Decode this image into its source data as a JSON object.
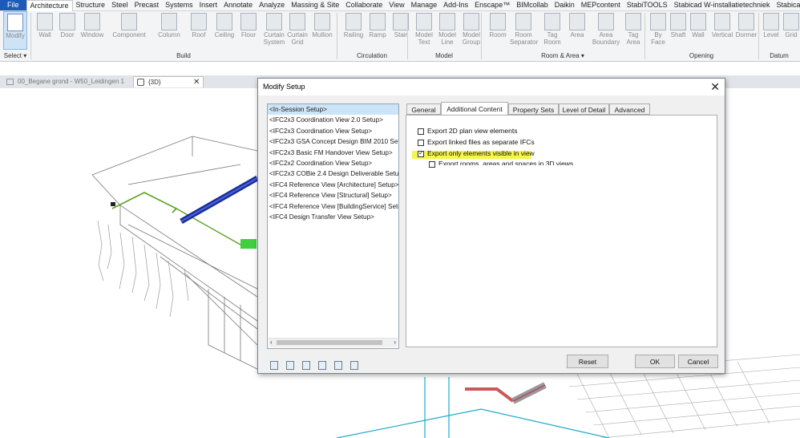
{
  "menu": {
    "tabs": [
      "File",
      "Architecture",
      "Structure",
      "Steel",
      "Precast",
      "Systems",
      "Insert",
      "Annotate",
      "Analyze",
      "Massing & Site",
      "Collaborate",
      "View",
      "Manage",
      "Add-Ins",
      "Enscape™",
      "BIMcollab",
      "Daikin",
      "MEPcontent",
      "StabiTOOLS",
      "Stabicad W-installatietechniek",
      "Stabica"
    ],
    "active_tab": "Architecture"
  },
  "ribbon": {
    "tools": [
      {
        "label": "Modify",
        "icon": "cursor-icon"
      },
      {
        "label": "Wall",
        "icon": "wall-icon"
      },
      {
        "label": "Door",
        "icon": "door-icon"
      },
      {
        "label": "Window",
        "icon": "window-icon"
      },
      {
        "label": "Component",
        "icon": "component-icon"
      },
      {
        "label": "Column",
        "icon": "column-icon"
      },
      {
        "label": "Roof",
        "icon": "roof-icon"
      },
      {
        "label": "Ceiling",
        "icon": "ceiling-icon"
      },
      {
        "label": "Floor",
        "icon": "floor-icon"
      },
      {
        "label": "Curtain System",
        "icon": "curtain-system-icon"
      },
      {
        "label": "Curtain Grid",
        "icon": "curtain-grid-icon"
      },
      {
        "label": "Mullion",
        "icon": "mullion-icon"
      },
      {
        "label": "Railing",
        "icon": "railing-icon"
      },
      {
        "label": "Ramp",
        "icon": "ramp-icon"
      },
      {
        "label": "Stair",
        "icon": "stair-icon"
      },
      {
        "label": "Model Text",
        "icon": "model-text-icon"
      },
      {
        "label": "Model Line",
        "icon": "model-line-icon"
      },
      {
        "label": "Model Group",
        "icon": "model-group-icon"
      },
      {
        "label": "Room",
        "icon": "room-icon"
      },
      {
        "label": "Room Separator",
        "icon": "room-separator-icon"
      },
      {
        "label": "Tag Room",
        "icon": "tag-room-icon"
      },
      {
        "label": "Area",
        "icon": "area-icon"
      },
      {
        "label": "Area Boundary",
        "icon": "area-boundary-icon"
      },
      {
        "label": "Tag Area",
        "icon": "tag-area-icon"
      },
      {
        "label": "By Face",
        "icon": "by-face-icon"
      },
      {
        "label": "Shaft",
        "icon": "shaft-icon"
      },
      {
        "label": "Wall",
        "icon": "wall-opening-icon"
      },
      {
        "label": "Vertical",
        "icon": "vertical-icon"
      },
      {
        "label": "Dormer",
        "icon": "dormer-icon"
      },
      {
        "label": "Level",
        "icon": "level-icon"
      },
      {
        "label": "Grid",
        "icon": "grid-icon"
      }
    ],
    "groups": [
      "Select ▾",
      "Build",
      "Circulation",
      "Model",
      "Room & Area ▾",
      "Opening",
      "Datum"
    ]
  },
  "view_tabs": [
    {
      "label": "00_Begane grond - W50_Leidingen 1",
      "icon": "floor-plan-icon"
    },
    {
      "label": "{3D}",
      "icon": "3d-view-icon"
    }
  ],
  "view_close": "✕",
  "dialog": {
    "title": "Modify Setup",
    "close": "✕",
    "setups": [
      "<In-Session Setup>",
      "<IFC2x3 Coordination View 2.0 Setup>",
      "<IFC2x3 Coordination View Setup>",
      "<IFC2x3 GSA Concept Design BIM 2010 Setup>",
      "<IFC2x3 Basic FM Handover View Setup>",
      "<IFC2x2 Coordination View Setup>",
      "<IFC2x3 COBie 2.4 Design Deliverable Setup>",
      "<IFC4 Reference View [Architecture] Setup>",
      "<IFC4 Reference View [Structural] Setup>",
      "<IFC4 Reference View [BuildingService] Setup>",
      "<IFC4 Design Transfer View Setup>"
    ],
    "selected_setup": "<In-Session Setup>",
    "scroll_left": "‹",
    "scroll_right": "›",
    "tabs": [
      "General",
      "Additional Content",
      "Property Sets",
      "Level of Detail",
      "Advanced"
    ],
    "active_tab": "Additional Content",
    "options": [
      {
        "label": "Export 2D plan view elements",
        "checked": false
      },
      {
        "label": "Export linked files as separate IFCs",
        "checked": false
      },
      {
        "label": "Export only elements visible in view",
        "checked": true
      },
      {
        "label": "Export rooms, areas and spaces in 3D views",
        "checked": false
      }
    ],
    "bottom_icons": [
      "new-setup-icon",
      "duplicate-setup-icon",
      "rename-setup-icon",
      "delete-setup-icon",
      "import-setup-icon",
      "export-setup-icon"
    ],
    "buttons": {
      "reset": "Reset",
      "ok": "OK",
      "cancel": "Cancel"
    }
  }
}
